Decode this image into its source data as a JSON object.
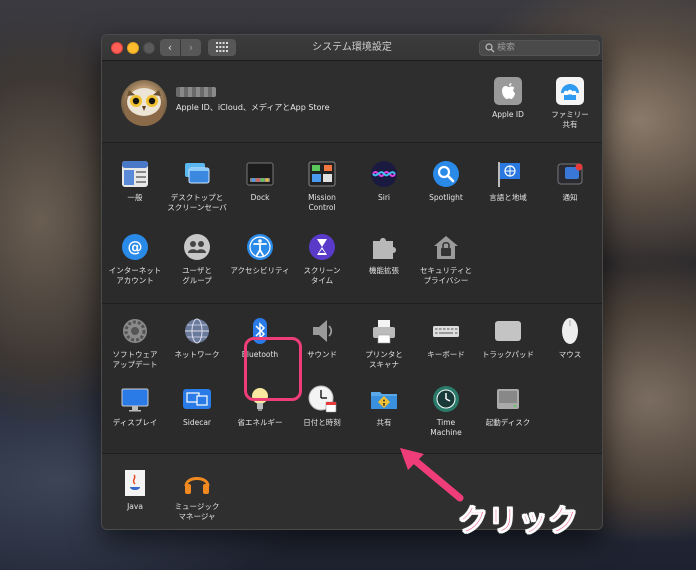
{
  "window": {
    "title": "システム環境設定",
    "search_placeholder": "検索",
    "back_glyph": "‹",
    "forward_glyph": "›"
  },
  "user": {
    "apple_id_label": "Apple ID、iCloud、メディアとApp Store",
    "avatar_icon": "owl-avatar-icon"
  },
  "account_panes": [
    {
      "id": "apple-id",
      "label": "Apple ID",
      "icon": "apple-logo-icon"
    },
    {
      "id": "family-sharing",
      "label": "ファミリー\n共有",
      "icon": "family-icon"
    }
  ],
  "panes_row1": [
    {
      "id": "general",
      "label": "一般",
      "icon": "general-icon"
    },
    {
      "id": "desktop",
      "label": "デスクトップと\nスクリーンセーバ",
      "icon": "desktop-icon"
    },
    {
      "id": "dock",
      "label": "Dock",
      "icon": "dock-icon"
    },
    {
      "id": "mission-control",
      "label": "Mission\nControl",
      "icon": "mission-control-icon"
    },
    {
      "id": "siri",
      "label": "Siri",
      "icon": "siri-icon"
    },
    {
      "id": "spotlight",
      "label": "Spotlight",
      "icon": "spotlight-icon"
    },
    {
      "id": "language",
      "label": "言語と地域",
      "icon": "flag-icon"
    },
    {
      "id": "notifications",
      "label": "通知",
      "icon": "notifications-icon"
    }
  ],
  "panes_row2": [
    {
      "id": "internet-accounts",
      "label": "インターネット\nアカウント",
      "icon": "at-sign-icon"
    },
    {
      "id": "users-groups",
      "label": "ユーザと\nグループ",
      "icon": "users-icon"
    },
    {
      "id": "accessibility",
      "label": "アクセシビリティ",
      "icon": "accessibility-icon"
    },
    {
      "id": "screen-time",
      "label": "スクリーン\nタイム",
      "icon": "hourglass-icon"
    },
    {
      "id": "extensions",
      "label": "機能拡張",
      "icon": "puzzle-icon"
    },
    {
      "id": "security",
      "label": "セキュリティと\nプライバシー",
      "icon": "house-lock-icon"
    }
  ],
  "panes_row3": [
    {
      "id": "software-update",
      "label": "ソフトウェア\nアップデート",
      "icon": "gear-icon"
    },
    {
      "id": "network",
      "label": "ネットワーク",
      "icon": "globe-icon"
    },
    {
      "id": "bluetooth",
      "label": "Bluetooth",
      "icon": "bluetooth-icon"
    },
    {
      "id": "sound",
      "label": "サウンド",
      "icon": "speaker-icon"
    },
    {
      "id": "printers",
      "label": "プリンタと\nスキャナ",
      "icon": "printer-icon"
    },
    {
      "id": "keyboard",
      "label": "キーボード",
      "icon": "keyboard-icon"
    },
    {
      "id": "trackpad",
      "label": "トラックパッド",
      "icon": "trackpad-icon"
    },
    {
      "id": "mouse",
      "label": "マウス",
      "icon": "mouse-icon"
    }
  ],
  "panes_row4": [
    {
      "id": "displays",
      "label": "ディスプレイ",
      "icon": "display-icon"
    },
    {
      "id": "sidecar",
      "label": "Sidecar",
      "icon": "sidecar-icon"
    },
    {
      "id": "energy-saver",
      "label": "省エネルギー",
      "icon": "lightbulb-icon"
    },
    {
      "id": "date-time",
      "label": "日付と時刻",
      "icon": "clock-icon"
    },
    {
      "id": "sharing",
      "label": "共有",
      "icon": "sharing-folder-icon"
    },
    {
      "id": "time-machine",
      "label": "Time\nMachine",
      "icon": "time-machine-icon"
    },
    {
      "id": "startup-disk",
      "label": "起動ディスク",
      "icon": "disk-icon"
    }
  ],
  "panes_other": [
    {
      "id": "java",
      "label": "Java",
      "icon": "java-icon"
    },
    {
      "id": "music-manager",
      "label": "ミュージック\nマネージャ",
      "icon": "headphones-icon"
    }
  ],
  "annotation": {
    "callout_text": "クリック",
    "color": "#ef3d7a"
  }
}
